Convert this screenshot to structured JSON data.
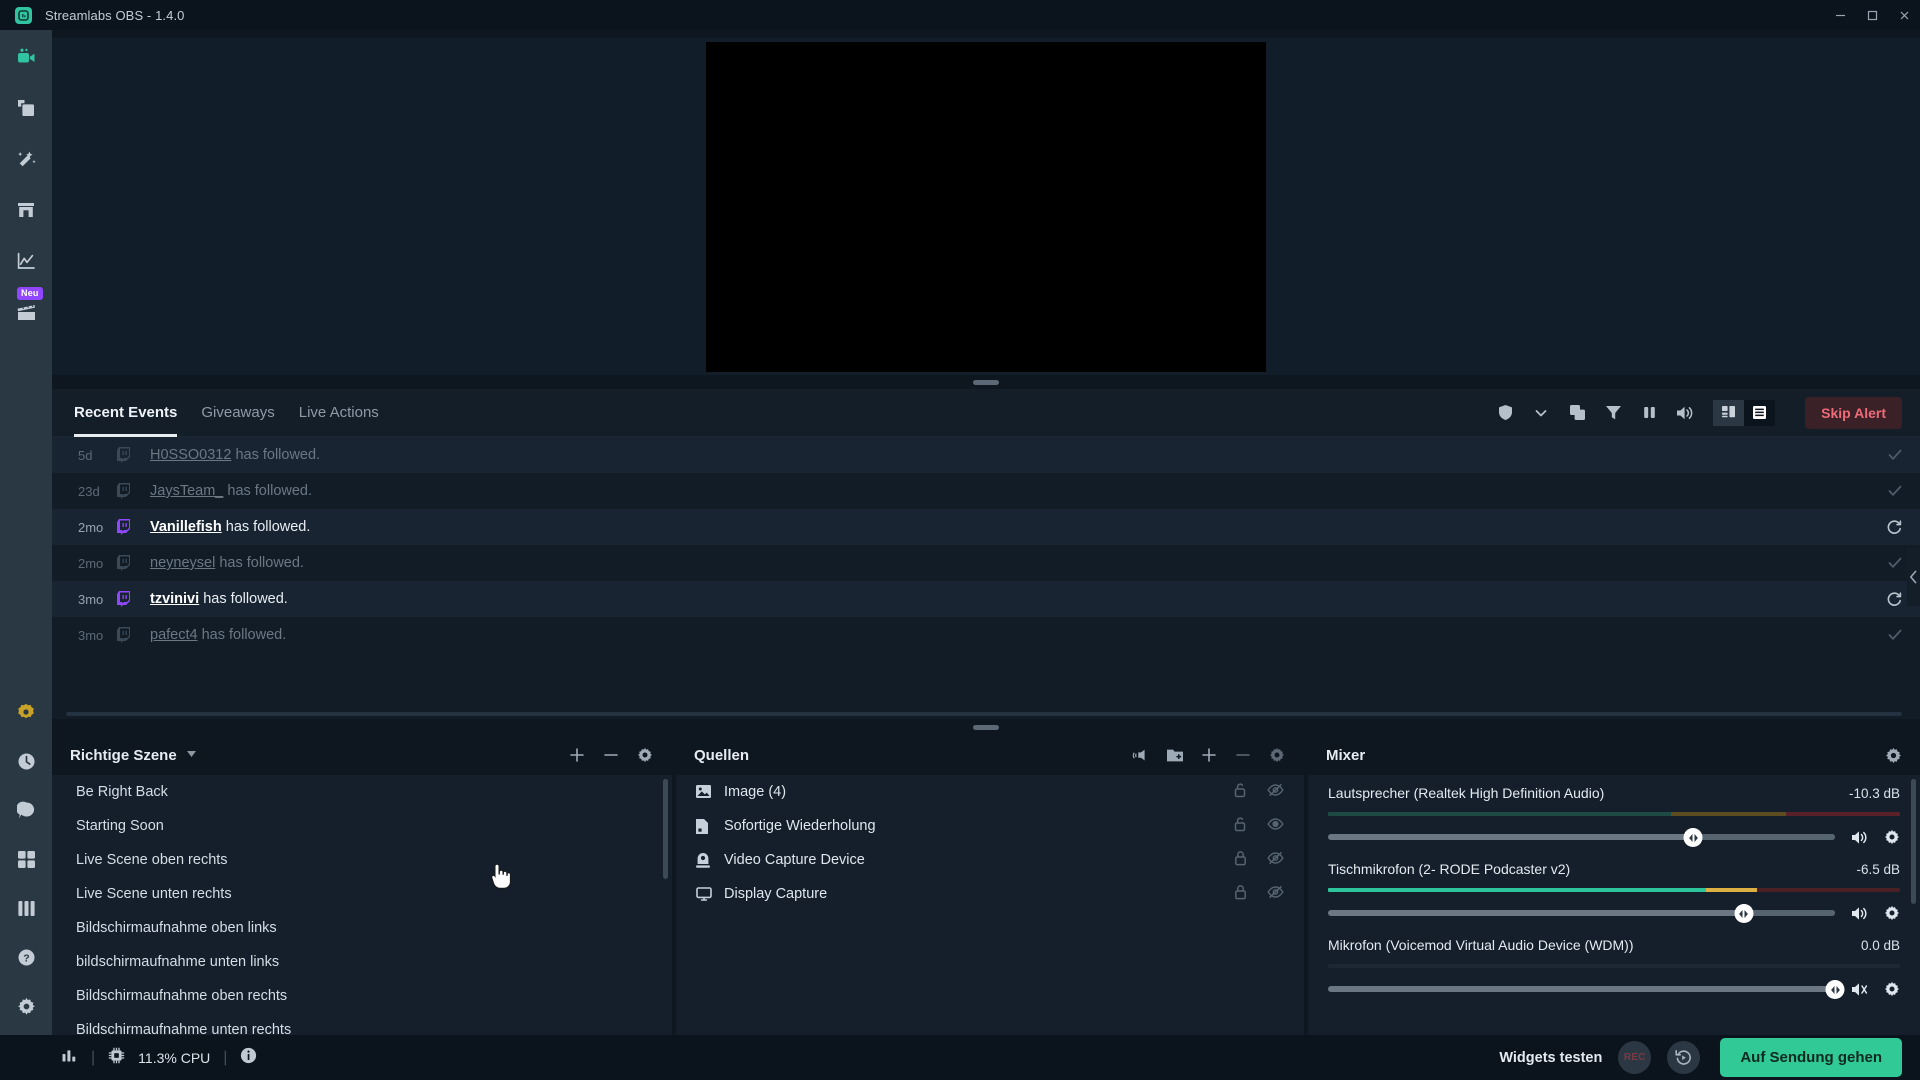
{
  "window": {
    "title": "Streamlabs OBS - 1.4.0",
    "logo_icon": "streamlabs-logo-icon",
    "minimize_label": "—",
    "maximize_label": "□",
    "close_label": "✕"
  },
  "nav": {
    "top_items": [
      {
        "name": "editor",
        "icon": "video-camera-icon",
        "active": true
      },
      {
        "name": "themes",
        "icon": "layers-window-icon",
        "active": false
      },
      {
        "name": "alert-box",
        "icon": "magic-wand-icon",
        "active": false
      },
      {
        "name": "store",
        "icon": "store-icon",
        "active": false
      },
      {
        "name": "dashboard",
        "icon": "line-chart-icon",
        "active": false
      },
      {
        "name": "highlighter",
        "icon": "film-clapper-icon",
        "active": false,
        "badge": "Neu"
      }
    ],
    "bottom_items": [
      {
        "name": "prime",
        "icon": "prime-star-icon"
      },
      {
        "name": "recent-activity",
        "icon": "clock-icon"
      },
      {
        "name": "chat",
        "icon": "chat-bubble-icon"
      },
      {
        "name": "apps",
        "icon": "grid-apps-icon"
      },
      {
        "name": "layout-editor",
        "icon": "columns-layout-icon"
      },
      {
        "name": "help",
        "icon": "question-mark-icon"
      },
      {
        "name": "settings",
        "icon": "gear-icon"
      }
    ]
  },
  "events": {
    "tabs": [
      {
        "label": "Recent Events",
        "active": true
      },
      {
        "label": "Giveaways",
        "active": false
      },
      {
        "label": "Live Actions",
        "active": false
      }
    ],
    "toolbar_icons": [
      "shield-icon",
      "chevron-down-icon",
      "copy-layers-icon",
      "filter-funnel-icon",
      "pause-icon",
      "speaker-volume-icon"
    ],
    "view_grid_icon": "grid-view-icon",
    "view_list_icon": "list-view-icon",
    "skip_alert_label": "Skip Alert",
    "rows": [
      {
        "time": "5d",
        "platform": "twitch-icon",
        "name": "H0SSO0312",
        "action": "has followed.",
        "bright": false,
        "status_icon": "check-icon"
      },
      {
        "time": "23d",
        "platform": "twitch-icon",
        "name": "JaysTeam_",
        "action": "has followed.",
        "bright": false,
        "status_icon": "check-icon"
      },
      {
        "time": "2mo",
        "platform": "twitch-icon",
        "name": "Vanillefish",
        "action": "has followed.",
        "bright": true,
        "status_icon": "replay-icon"
      },
      {
        "time": "2mo",
        "platform": "twitch-icon",
        "name": "neyneysel",
        "action": "has followed.",
        "bright": false,
        "status_icon": "check-icon"
      },
      {
        "time": "3mo",
        "platform": "twitch-icon",
        "name": "tzvinivi",
        "action": "has followed.",
        "bright": true,
        "status_icon": "replay-icon"
      },
      {
        "time": "3mo",
        "platform": "twitch-icon",
        "name": "pafect4",
        "action": "has followed.",
        "bright": false,
        "status_icon": "check-icon"
      }
    ]
  },
  "scenes": {
    "title": "Richtige Szene",
    "caret_icon": "chevron-down-icon",
    "tools": [
      {
        "name": "add-scene",
        "icon": "plus-icon"
      },
      {
        "name": "remove-scene",
        "icon": "minus-icon"
      },
      {
        "name": "scene-settings",
        "icon": "gear-icon"
      }
    ],
    "items": [
      "Be Right Back",
      "Starting Soon",
      "Live Scene oben rechts",
      "Live Scene unten rechts",
      "Bildschirmaufnahme oben links",
      "bildschirmaufnahme unten links",
      "Bildschirmaufnahme oben rechts",
      "Bildschirmaufnahme unten rechts"
    ]
  },
  "sources": {
    "title": "Quellen",
    "tools": [
      {
        "name": "add-audio-source",
        "icon": "audio-wave-icon"
      },
      {
        "name": "add-folder",
        "icon": "folder-plus-icon"
      },
      {
        "name": "add-source",
        "icon": "plus-icon"
      },
      {
        "name": "remove-source",
        "icon": "minus-icon"
      },
      {
        "name": "source-settings",
        "icon": "gear-icon"
      }
    ],
    "items": [
      {
        "label": "Image (4)",
        "icon": "image-icon",
        "lock_icon": "unlock-icon",
        "visibility_icon": "eye-off-icon"
      },
      {
        "label": "Sofortige Wiederholung",
        "icon": "file-icon",
        "lock_icon": "unlock-icon",
        "visibility_icon": "eye-icon"
      },
      {
        "label": "Video Capture Device",
        "icon": "webcam-icon",
        "lock_icon": "lock-icon",
        "visibility_icon": "eye-off-icon"
      },
      {
        "label": "Display Capture",
        "icon": "monitor-icon",
        "lock_icon": "lock-icon",
        "visibility_icon": "eye-off-icon"
      }
    ]
  },
  "mixer": {
    "title": "Mixer",
    "settings_icon": "gear-icon",
    "channels": [
      {
        "label": "Lautsprecher (Realtek High Definition Audio)",
        "db": "-10.3 dB",
        "meter": {
          "green_pct": 60,
          "yellow_pct": 20,
          "red_pct": 20,
          "active": false
        },
        "volume_pct": 72,
        "mute_icon": "speaker-icon",
        "settings_icon": "gear-icon"
      },
      {
        "label": "Tischmikrofon (2- RODE Podcaster v2)",
        "db": "-6.5 dB",
        "meter": {
          "green_pct": 66,
          "yellow_pct": 9,
          "red_pct": 25,
          "active": true
        },
        "volume_pct": 82,
        "mute_icon": "speaker-icon",
        "settings_icon": "gear-icon"
      },
      {
        "label": "Mikrofon (Voicemod Virtual Audio Device (WDM))",
        "db": "0.0 dB",
        "meter": {
          "green_pct": 0,
          "yellow_pct": 0,
          "red_pct": 0,
          "active": false
        },
        "volume_pct": 100,
        "mute_icon": "speaker-icon",
        "settings_icon": "gear-icon"
      }
    ]
  },
  "status": {
    "perf_icon": "bar-chart-icon",
    "cpu_icon": "cpu-chip-icon",
    "cpu_label": "11.3% CPU",
    "info_icon": "info-icon",
    "widgets_label": "Widgets testen",
    "record_label": "REC",
    "replay_icon": "replay-buffer-icon",
    "golive_label": "Auf Sendung gehen"
  },
  "collapse_chevron_icon": "chevron-left-icon",
  "colors": {
    "accent_green": "#31c995",
    "twitch_purple": "#9146ff",
    "skip_alert_red": "#ee6b77",
    "panel_bg": "#141f2b",
    "window_bg": "#0e1620"
  }
}
